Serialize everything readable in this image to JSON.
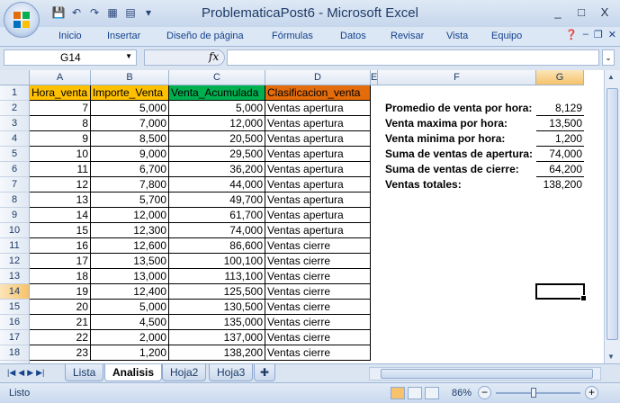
{
  "window": {
    "title": "ProblematicaPost6 - Microsoft Excel",
    "controls": [
      "_",
      "□",
      "X"
    ]
  },
  "ribbon": {
    "tabs": [
      "Inicio",
      "Insertar",
      "Diseño de página",
      "Fórmulas",
      "Datos",
      "Revisar",
      "Vista",
      "Equipo"
    ],
    "help_icon": "help-icon"
  },
  "formula_bar": {
    "name_box": "G14",
    "fx_label": "fx",
    "value": ""
  },
  "columns": [
    "A",
    "B",
    "C",
    "D",
    "E",
    "F",
    "G"
  ],
  "rows": [
    "1",
    "2",
    "3",
    "4",
    "5",
    "6",
    "7",
    "8",
    "9",
    "10",
    "11",
    "12",
    "13",
    "14",
    "15",
    "16",
    "17",
    "18",
    "19"
  ],
  "selected_cell": "G14",
  "headers": {
    "A": "Hora_venta",
    "B": "Importe_Venta",
    "C": "Venta_Acumulada",
    "D": "Clasificacion_venta"
  },
  "header_colors": {
    "A": "#ffc000",
    "B": "#ffc000",
    "C": "#00b050",
    "D": "#e46c0a"
  },
  "table": [
    [
      "7",
      "5,000",
      "5,000",
      "Ventas apertura"
    ],
    [
      "8",
      "7,000",
      "12,000",
      "Ventas apertura"
    ],
    [
      "9",
      "8,500",
      "20,500",
      "Ventas apertura"
    ],
    [
      "10",
      "9,000",
      "29,500",
      "Ventas apertura"
    ],
    [
      "11",
      "6,700",
      "36,200",
      "Ventas apertura"
    ],
    [
      "12",
      "7,800",
      "44,000",
      "Ventas apertura"
    ],
    [
      "13",
      "5,700",
      "49,700",
      "Ventas apertura"
    ],
    [
      "14",
      "12,000",
      "61,700",
      "Ventas apertura"
    ],
    [
      "15",
      "12,300",
      "74,000",
      "Ventas apertura"
    ],
    [
      "16",
      "12,600",
      "86,600",
      "Ventas cierre"
    ],
    [
      "17",
      "13,500",
      "100,100",
      "Ventas cierre"
    ],
    [
      "18",
      "13,000",
      "113,100",
      "Ventas cierre"
    ],
    [
      "19",
      "12,400",
      "125,500",
      "Ventas cierre"
    ],
    [
      "20",
      "5,000",
      "130,500",
      "Ventas cierre"
    ],
    [
      "21",
      "4,500",
      "135,000",
      "Ventas cierre"
    ],
    [
      "22",
      "2,000",
      "137,000",
      "Ventas cierre"
    ],
    [
      "23",
      "1,200",
      "138,200",
      "Ventas cierre"
    ]
  ],
  "stats": [
    {
      "label": "Promedio de venta por hora:",
      "value": "8,129"
    },
    {
      "label": "Venta maxima por hora:",
      "value": "13,500"
    },
    {
      "label": "Venta minima por hora:",
      "value": "1,200"
    },
    {
      "label": "Suma de ventas de apertura:",
      "value": "74,000"
    },
    {
      "label": "Suma de ventas de cierre:",
      "value": "64,200"
    },
    {
      "label": "Ventas totales:",
      "value": "138,200"
    }
  ],
  "sheet_tabs": [
    "Lista",
    "Analisis",
    "Hoja2",
    "Hoja3"
  ],
  "active_sheet": "Analisis",
  "status": {
    "text": "Listo",
    "zoom": "86%",
    "zoom_minus": "−",
    "zoom_plus": "+"
  }
}
